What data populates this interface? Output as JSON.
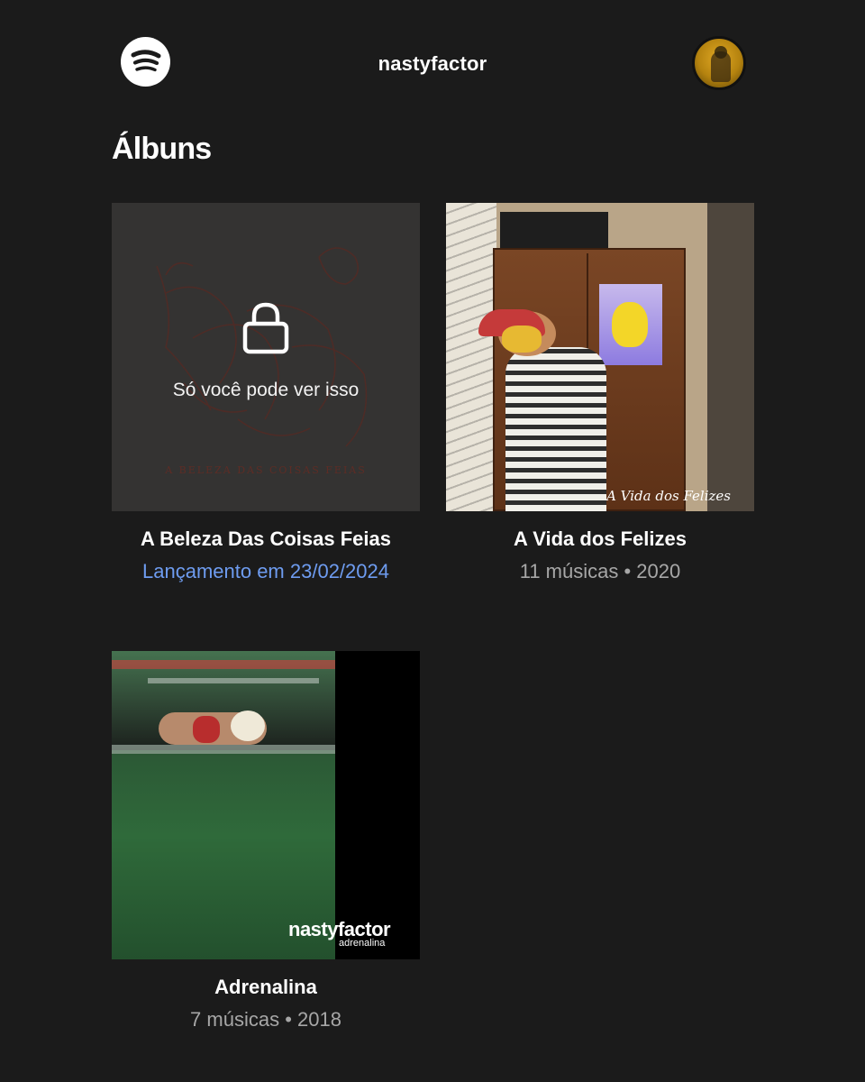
{
  "header": {
    "title": "nastyfactor",
    "logo_icon": "spotify-logo-icon",
    "avatar_icon": "profile-avatar"
  },
  "section": {
    "title": "Álbuns"
  },
  "albums": [
    {
      "title": "A Beleza Das Coisas Feias",
      "meta": "Lançamento em 23/02/2024",
      "locked": true,
      "lock_text": "Só você pode ver isso",
      "cover_caption": "A BELEZA DAS COISAS FEIAS",
      "meta_color": "#6e9cf0"
    },
    {
      "title": "A Vida dos Felizes",
      "meta": "11 músicas • 2020",
      "cover_caption": "A Vida dos Felizes"
    },
    {
      "title": "Adrenalina",
      "meta": "7 músicas • 2018",
      "cover_caption": "nastyfactor",
      "cover_subcaption": "adrenalina"
    }
  ],
  "colors": {
    "background": "#1b1b1b",
    "text": "#ffffff",
    "secondary_text": "#a7a7a7",
    "release_text": "#6e9cf0"
  }
}
